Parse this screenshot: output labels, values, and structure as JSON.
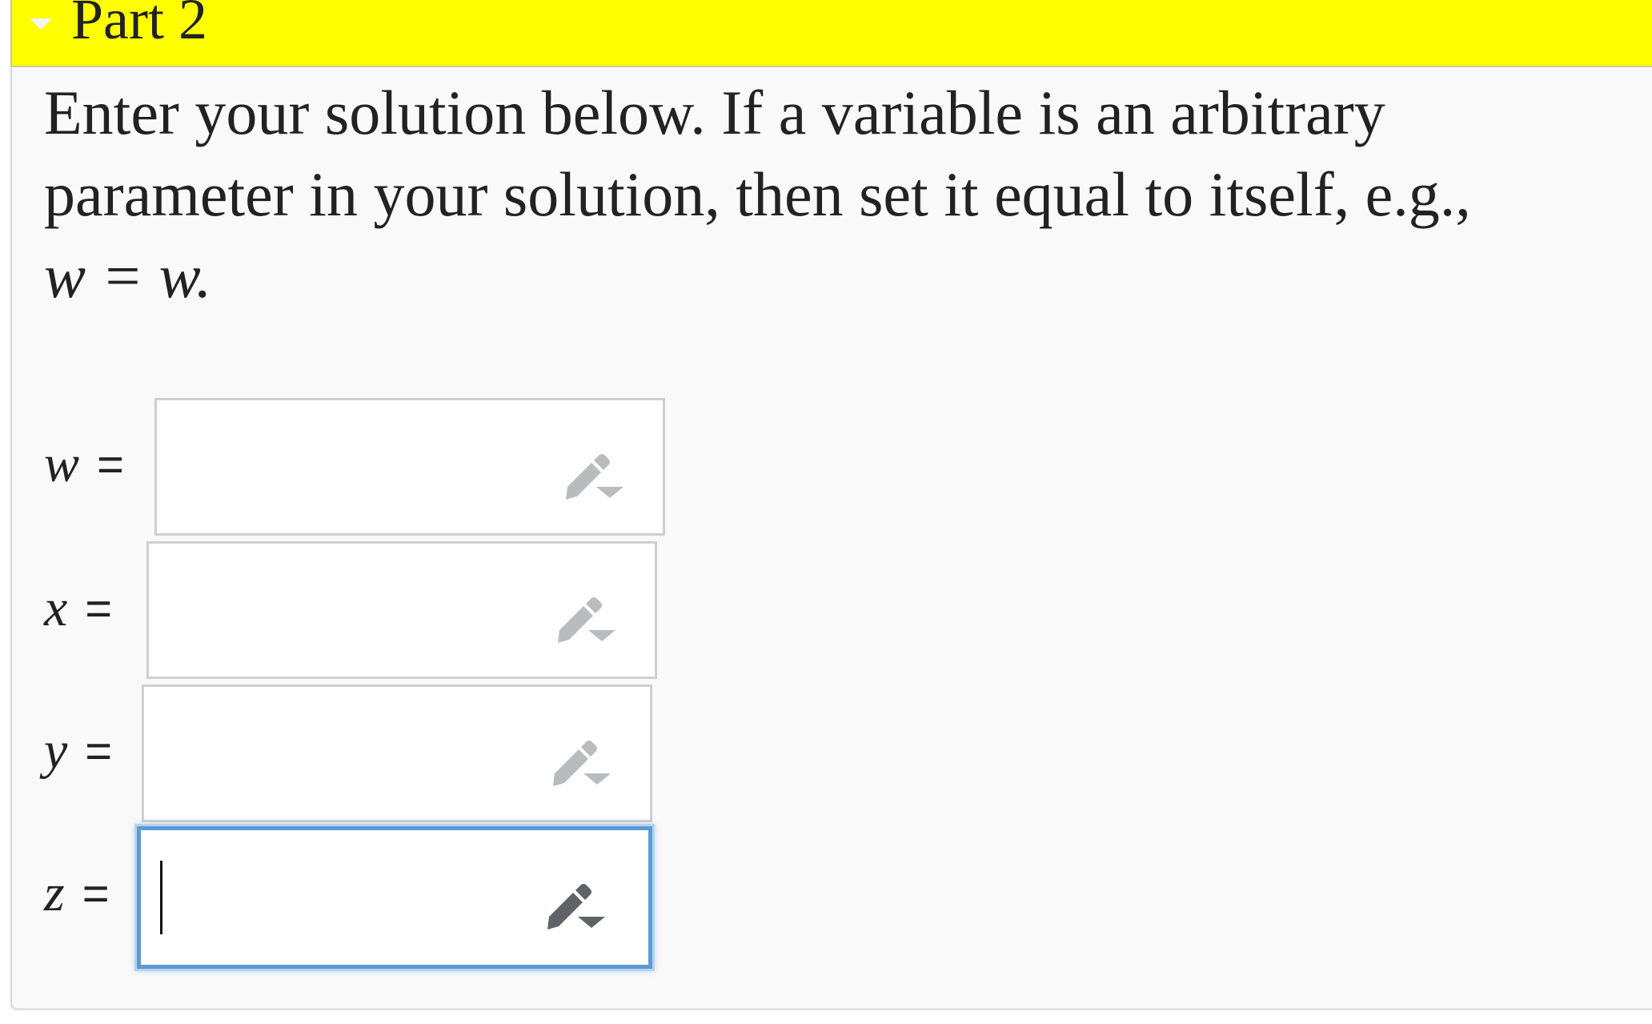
{
  "header": {
    "title": "Part 2",
    "caret_icon": "chevron-down-icon"
  },
  "instructions": {
    "line1": "Enter your solution below. If a variable is an arbitrary",
    "line2": "parameter in your solution, then set it equal to itself, e.g.,",
    "example": "w = w."
  },
  "fields": [
    {
      "variable": "w",
      "equals": "=",
      "value": "",
      "focused": false,
      "tool_icon": "pencil-dropdown-icon"
    },
    {
      "variable": "x",
      "equals": "=",
      "value": "",
      "focused": false,
      "tool_icon": "pencil-dropdown-icon"
    },
    {
      "variable": "y",
      "equals": "=",
      "value": "",
      "focused": false,
      "tool_icon": "pencil-dropdown-icon"
    },
    {
      "variable": "z",
      "equals": "=",
      "value": "",
      "focused": true,
      "tool_icon": "pencil-dropdown-icon"
    }
  ],
  "colors": {
    "header_bg": "#ffff00",
    "focus_border": "#5b9bd5",
    "pencil_inactive": "#b9bcbf",
    "pencil_active": "#5f6368"
  }
}
